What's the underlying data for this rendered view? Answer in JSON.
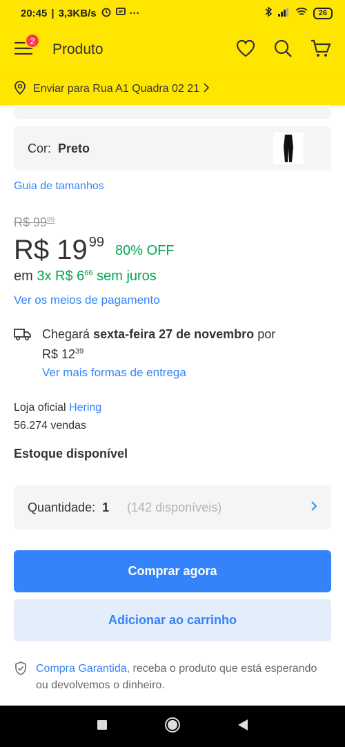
{
  "status_bar": {
    "time": "20:45",
    "speed": "3,3KB/s",
    "battery": "26"
  },
  "header": {
    "title": "Produto",
    "cart_badge": "2"
  },
  "address": {
    "text": "Enviar para Rua A1 Quadra 02 21"
  },
  "color": {
    "label": "Cor:",
    "value": "Preto"
  },
  "size_guide": "Guia de tamanhos",
  "price": {
    "old_main": "R$ 99",
    "old_cents": "99",
    "current_main": "R$ 19",
    "current_cents": "99",
    "discount": "80% OFF",
    "install_prefix": "em",
    "install_highlight": "3x R$ 6",
    "install_cents": "66",
    "install_suffix": "sem juros",
    "payment_link": "Ver os meios de pagamento"
  },
  "delivery": {
    "prefix": "Chegará",
    "date": "sexta-feira 27 de novembro",
    "by": "por",
    "price_main": "R$ 12",
    "price_cents": "39",
    "link": "Ver mais formas de entrega"
  },
  "seller": {
    "label": "Loja oficial",
    "name": "Hering",
    "sales": "56.274 vendas"
  },
  "stock": {
    "title": "Estoque disponível",
    "qty_label": "Quantidade:",
    "qty_value": "1",
    "available": "(142 disponíveis)"
  },
  "actions": {
    "buy": "Comprar agora",
    "add_cart": "Adicionar ao carrinho"
  },
  "guarantee": {
    "link": "Compra Garantida",
    "text": ", receba o produto que está esperando ou devolvemos o dinheiro."
  },
  "colors": {
    "brand_yellow": "#ffe600",
    "primary_blue": "#3483fa",
    "discount_green": "#00a650",
    "badge_red": "#f23d4f"
  }
}
